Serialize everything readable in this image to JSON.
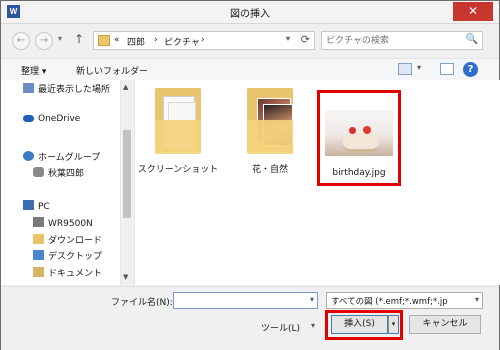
{
  "window": {
    "title": "図の挿入",
    "app_icon": "W",
    "close_glyph": "✕"
  },
  "address": {
    "back_glyph": "←",
    "forward_glyph": "→",
    "up_glyph": "↑",
    "dropdown_glyph": "▾",
    "breadcrumb": [
      "«",
      "四郎",
      "›",
      "ピクチャ",
      "›"
    ],
    "refresh_glyph": "⟳"
  },
  "search": {
    "placeholder": "ピクチャの検索",
    "icon_glyph": "🔍"
  },
  "toolbar": {
    "organize": "整理 ▾",
    "new_folder": "新しいフォルダー",
    "view_dd": "▾",
    "help_glyph": "?"
  },
  "nav": {
    "items": [
      {
        "label": "最近表示した場所",
        "icon": "recent-places-icon"
      },
      {
        "label": "OneDrive",
        "icon": "onedrive-icon"
      },
      {
        "label": "ホームグループ",
        "icon": "homegroup-icon"
      },
      {
        "label": "秋葉四郎",
        "icon": "user-icon"
      },
      {
        "label": "PC",
        "icon": "pc-icon"
      },
      {
        "label": "WR9500N",
        "icon": "network-drive-icon"
      },
      {
        "label": "ダウンロード",
        "icon": "downloads-icon"
      },
      {
        "label": "デスクトップ",
        "icon": "desktop-icon"
      },
      {
        "label": "ドキュメント",
        "icon": "documents-icon"
      }
    ],
    "scroll_up": "▲",
    "scroll_down": "▼"
  },
  "files": [
    {
      "name": "スクリーンショット",
      "type": "folder"
    },
    {
      "name": "花・自然",
      "type": "folder"
    },
    {
      "name": "birthday.jpg",
      "type": "image",
      "selected": true
    }
  ],
  "bottom": {
    "filename_label": "ファイル名(N):",
    "filename_value": "",
    "filetype": "すべての図 (*.emf;*.wmf;*.jp",
    "tools": "ツール(L)",
    "insert": "挿入(S)",
    "cancel": "キャンセル",
    "dd_glyph": "▾"
  },
  "colors": {
    "highlight": "#e00000",
    "close": "#c7372f",
    "folder": "#e9c46e"
  }
}
